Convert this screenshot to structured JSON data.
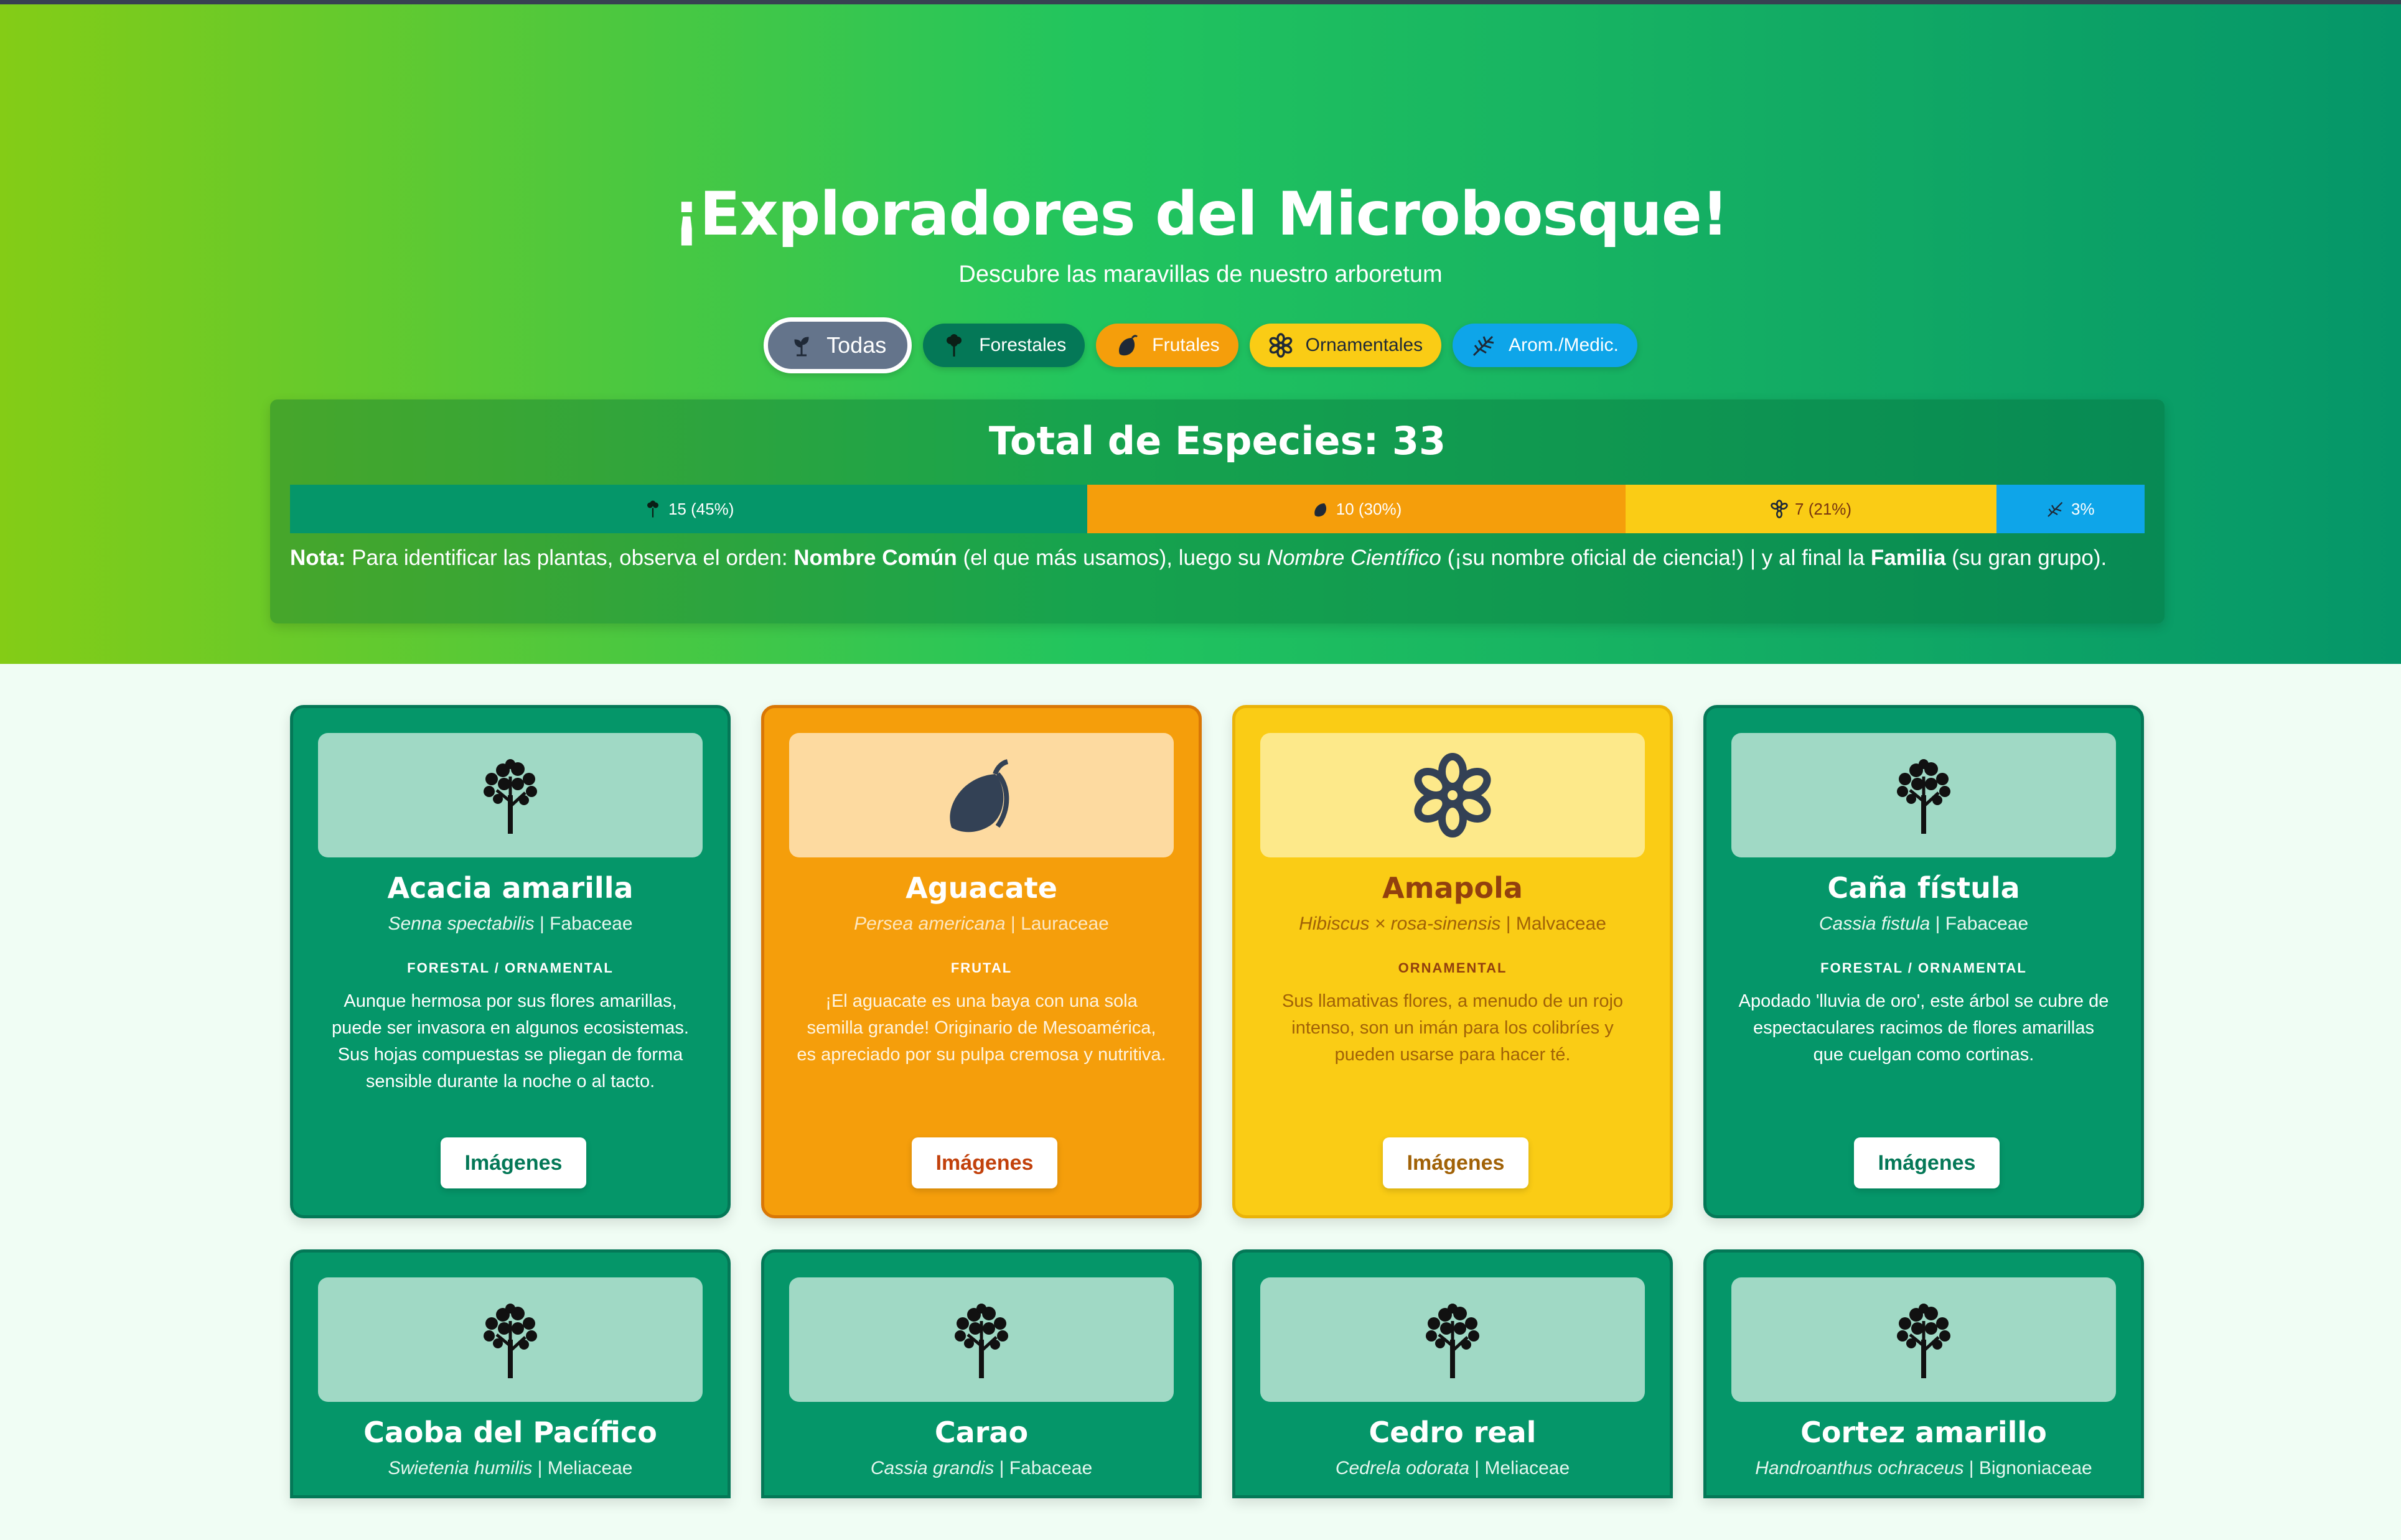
{
  "header": {
    "title": "¡Exploradores del Microbosque!",
    "subtitle": "Descubre las maravillas de nuestro arboretum"
  },
  "filters": [
    {
      "label": "Todas",
      "icon": "sprout-icon",
      "active": true
    },
    {
      "label": "Forestales",
      "icon": "tree-icon",
      "color": "#047857"
    },
    {
      "label": "Frutales",
      "icon": "mango-icon",
      "color": "#f59e0b"
    },
    {
      "label": "Ornamentales",
      "icon": "flower-icon",
      "color": "#facc15"
    },
    {
      "label": "Arom./Medic.",
      "icon": "herb-icon",
      "color": "#0ea5e9"
    }
  ],
  "stats": {
    "title": "Total de Especies: 33",
    "segments": [
      {
        "label": "15 (45%)",
        "fraction": 0.43,
        "color": "#059669",
        "icon": "tree-icon"
      },
      {
        "label": "10 (30%)",
        "fraction": 0.29,
        "color": "#f59e0b",
        "icon": "mango-icon"
      },
      {
        "label": "7 (21%)",
        "fraction": 0.2,
        "color": "#facc15",
        "icon": "flower-icon"
      },
      {
        "label": "3%",
        "fraction": 0.08,
        "color": "#0ea5e9",
        "icon": "herb-icon"
      }
    ],
    "note": {
      "prefix": "Nota:",
      "t1": " Para identificar las plantas, observa el orden: ",
      "b1": "Nombre Común",
      "t2": " (el que más usamos), luego su ",
      "i1": "Nombre Científico",
      "t3": " (¡su nombre oficial de ciencia!) | y al final la ",
      "b2": "Familia",
      "t4": " (su gran grupo)."
    }
  },
  "cards": [
    {
      "name": "Acacia amarilla",
      "sci": "Senna spectabilis",
      "family": "Fabaceae",
      "category": "FORESTAL / ORNAMENTAL",
      "type": "forestal",
      "icon": "tree-icon",
      "desc": "Aunque hermosa por sus flores amarillas, puede ser invasora en algunos ecosistemas. Sus hojas compuestas se pliegan de forma sensible durante la noche o al tacto.",
      "button": "Imágenes"
    },
    {
      "name": "Aguacate",
      "sci": "Persea americana",
      "family": "Lauraceae",
      "category": "FRUTAL",
      "type": "frutal",
      "icon": "mango-icon",
      "desc": "¡El aguacate es una baya con una sola semilla grande! Originario de Mesoamérica, es apreciado por su pulpa cremosa y nutritiva.",
      "button": "Imágenes"
    },
    {
      "name": "Amapola",
      "sci": "Hibiscus × rosa-sinensis",
      "family": "Malvaceae",
      "category": "ORNAMENTAL",
      "type": "ornamental",
      "icon": "flower-icon",
      "desc": "Sus llamativas flores, a menudo de un rojo intenso, son un imán para los colibríes y pueden usarse para hacer té.",
      "button": "Imágenes"
    },
    {
      "name": "Caña fístula",
      "sci": "Cassia fistula",
      "family": "Fabaceae",
      "category": "FORESTAL / ORNAMENTAL",
      "type": "forestal",
      "icon": "tree-icon",
      "desc": "Apodado 'lluvia de oro', este árbol se cubre de espectaculares racimos de flores amarillas que cuelgan como cortinas.",
      "button": "Imágenes"
    },
    {
      "name": "Caoba del Pacífico",
      "sci": "Swietenia humilis",
      "family": "Meliaceae",
      "type": "forestal",
      "icon": "tree-icon"
    },
    {
      "name": "Carao",
      "sci": "Cassia grandis",
      "family": "Fabaceae",
      "type": "forestal",
      "icon": "tree-icon"
    },
    {
      "name": "Cedro real",
      "sci": "Cedrela odorata",
      "family": "Meliaceae",
      "type": "forestal",
      "icon": "tree-icon"
    },
    {
      "name": "Cortez amarillo",
      "sci": "Handroanthus ochraceus",
      "family": "Bignoniaceae",
      "type": "forestal",
      "icon": "tree-icon"
    }
  ]
}
